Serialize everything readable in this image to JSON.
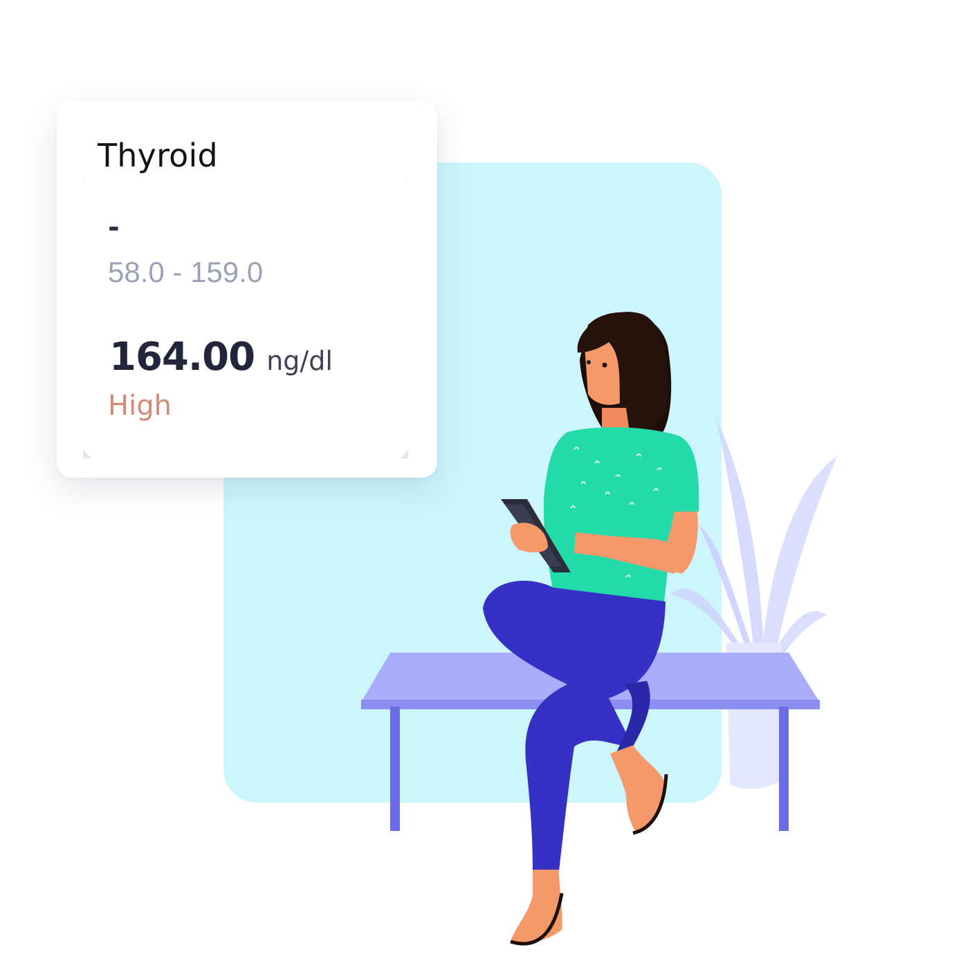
{
  "card": {
    "title": "Thyroid",
    "previous_value": "-",
    "reference_range": "58.0 - 159.0",
    "value": "164.00",
    "unit": "ng/dl",
    "status": "High"
  },
  "colors": {
    "panel": "#cdf6fc",
    "status_high": "#d08a76",
    "bench": "#a9acf8",
    "shirt": "#22dba8",
    "pants": "#3431c4"
  }
}
